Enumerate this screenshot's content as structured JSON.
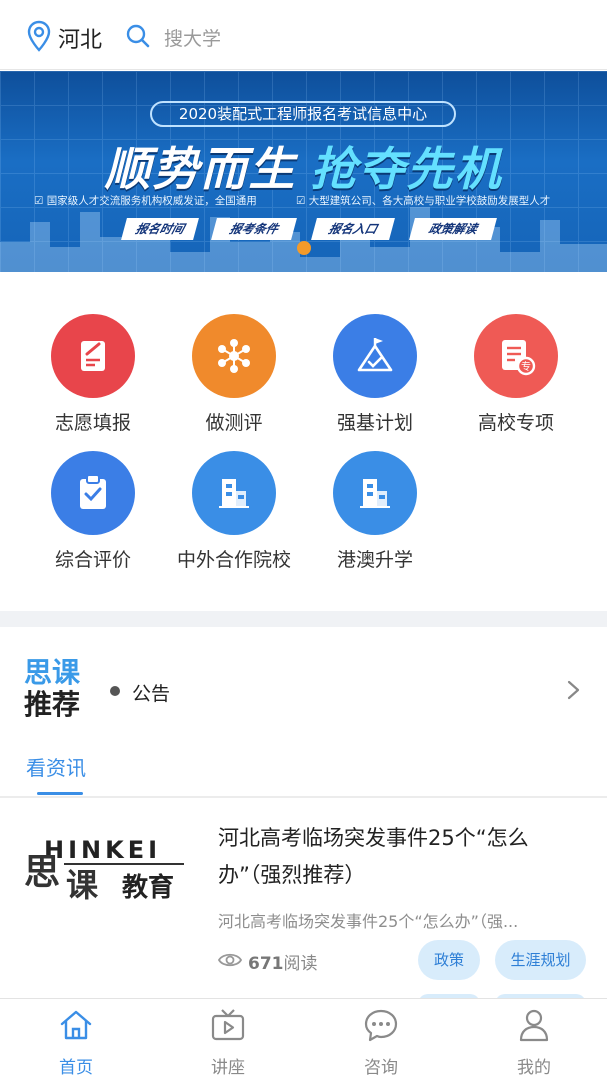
{
  "header": {
    "location": "河北",
    "search_placeholder": "搜大学",
    "location_icon": "location-pin-icon",
    "search_icon": "search-icon"
  },
  "banner": {
    "pill_text": "2020装配式工程师报名考试信息中心",
    "headline_left": "顺势而生",
    "headline_right": "抢夺先机",
    "sub_left": "国家级人才交流服务机构权威发证，全国通用",
    "sub_right": "大型建筑公司、各大高校与职业学校鼓励发展型人才",
    "tags": [
      "报名时间",
      "报考条件",
      "报名入口",
      "政策解读"
    ],
    "active_dot_color": "#f39a2a"
  },
  "features": [
    {
      "label": "志愿填报",
      "color": "#e8454b",
      "icon": "form-edit-icon"
    },
    {
      "label": "做测评",
      "color": "#f08a2c",
      "icon": "network-icon"
    },
    {
      "label": "强基计划",
      "color": "#3b7ee6",
      "icon": "mountain-flag-icon"
    },
    {
      "label": "高校专项",
      "color": "#ef5a55",
      "icon": "document-badge-icon"
    },
    {
      "label": "综合评价",
      "color": "#3b7ee6",
      "icon": "clipboard-check-icon"
    },
    {
      "label": "中外合作院校",
      "color": "#3a8ee6",
      "icon": "building-icon"
    },
    {
      "label": "港澳升学",
      "color": "#3a8ee6",
      "icon": "building-icon"
    }
  ],
  "notice": {
    "logo_line1": "思课",
    "logo_line2": "推荐",
    "text": "公告"
  },
  "tabs": {
    "active": "看资讯"
  },
  "article": {
    "thumb_top": "HINKEI",
    "thumb_left": "思",
    "thumb_mid": "课",
    "thumb_right": "教育",
    "title": "河北高考临场突发事件25个“怎么办”（强烈推荐）",
    "summary": "河北高考临场突发事件25个“怎么办”（强...",
    "read_count": "671",
    "read_suffix": "阅读",
    "chips": [
      "政策",
      "生涯规划"
    ]
  },
  "bottom_nav": [
    {
      "label": "首页",
      "icon": "home-icon",
      "active": true
    },
    {
      "label": "讲座",
      "icon": "tv-play-icon",
      "active": false
    },
    {
      "label": "咨询",
      "icon": "chat-bubble-icon",
      "active": false
    },
    {
      "label": "我的",
      "icon": "user-icon",
      "active": false
    }
  ],
  "colors": {
    "accent": "#3a8ee6",
    "banner_bg": "#1564b8",
    "chip_bg": "#d8ecfb"
  }
}
